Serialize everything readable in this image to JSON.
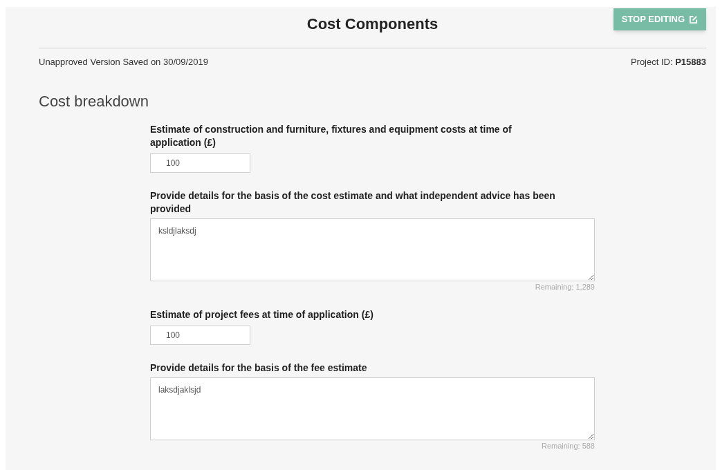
{
  "title": "Cost Components",
  "stop_editing_button": "STOP EDITING",
  "saved_status": "Unapproved Version Saved on 30/09/2019",
  "project_id": "Project ID: **P15883**",
  "section_heading": "Cost breakdown",
  "fields": [
    {
      "kind": "input",
      "label": "Estimate of construction and furniture, fixtures and equipment costs at time of application (£)",
      "value": "100"
    },
    {
      "kind": "textarea",
      "label": "Provide details for the basis of the cost estimate and what independent advice has been provided",
      "value": "ksldjlaksdj",
      "remaining": "Remaining: 1,289"
    },
    {
      "kind": "input",
      "label": "Estimate of project fees at time of application (£)",
      "value": "100"
    },
    {
      "kind": "textarea",
      "label": "Provide details for the basis of the fee estimate",
      "value": "laksdjaklsjd",
      "remaining": "Remaining: 588"
    }
  ]
}
